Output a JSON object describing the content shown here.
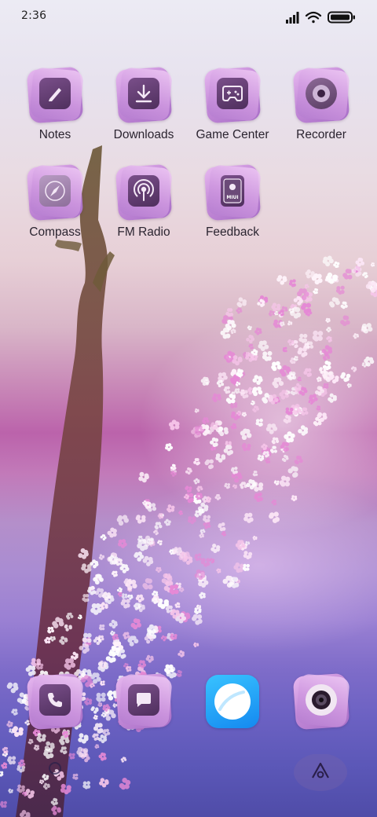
{
  "status_bar": {
    "time": "2:36",
    "icons": [
      "signal-icon",
      "wifi-icon",
      "battery-icon"
    ]
  },
  "apps": [
    {
      "label": "Notes",
      "icon": "notes-icon"
    },
    {
      "label": "Downloads",
      "icon": "download-icon"
    },
    {
      "label": "Game Center",
      "icon": "gamepad-icon"
    },
    {
      "label": "Recorder",
      "icon": "recorder-icon"
    },
    {
      "label": "Compass",
      "icon": "compass-icon"
    },
    {
      "label": "FM Radio",
      "icon": "radio-icon"
    },
    {
      "label": "Feedback",
      "icon": "feedback-icon"
    }
  ],
  "feedback_icon_text": "MIUI",
  "dock": [
    {
      "icon": "phone-icon"
    },
    {
      "icon": "messages-icon"
    },
    {
      "icon": "browser-icon",
      "color": "#19a6f5"
    },
    {
      "icon": "camera-icon"
    }
  ],
  "colors": {
    "icon_tile": "#c48ad8",
    "icon_inner": "#5f3a6e",
    "browser_blue": "#19a6f5"
  }
}
